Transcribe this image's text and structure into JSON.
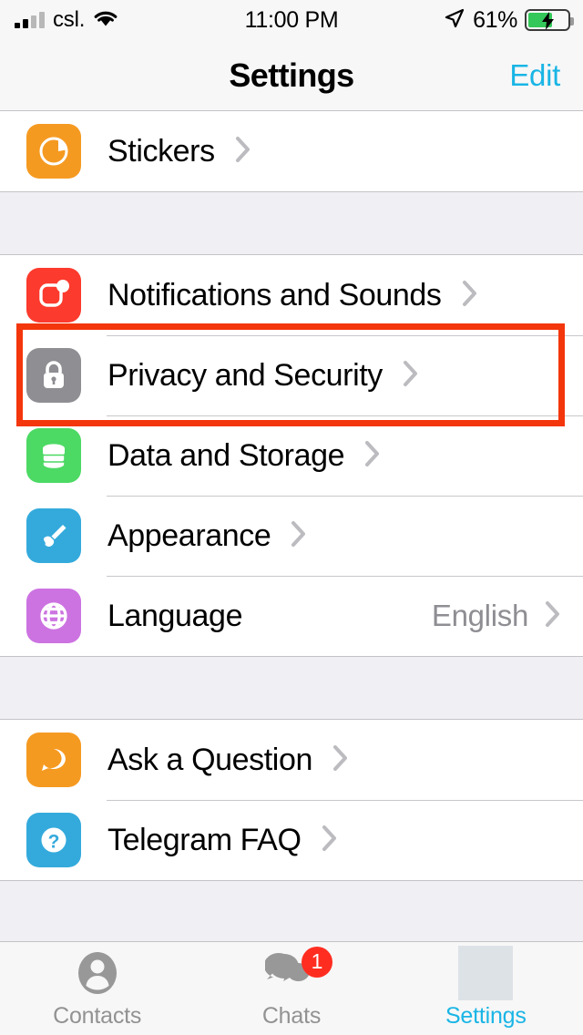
{
  "status_bar": {
    "carrier": "csl.",
    "signal_icon": "cellular-signal-icon",
    "wifi_icon": "wifi-icon",
    "time": "11:00 PM",
    "location_icon": "location-arrow-icon",
    "battery_percent": "61%",
    "battery_level": 61,
    "battery_charging": true,
    "battery_color": "#34c759"
  },
  "nav_bar": {
    "title": "Settings",
    "edit_label": "Edit",
    "accent_color": "#19b5e5"
  },
  "highlight": {
    "color": "#f4360c",
    "target": "Privacy and Security"
  },
  "groups": [
    {
      "rows": [
        {
          "label": "Stickers",
          "icon": "stickers-icon",
          "icon_color": "#f59a21",
          "value": "",
          "chevron": true
        }
      ]
    },
    {
      "rows": [
        {
          "label": "Notifications and Sounds",
          "icon": "notifications-icon",
          "icon_color": "#fc3a2d",
          "value": "",
          "chevron": true
        },
        {
          "label": "Privacy and Security",
          "icon": "lock-icon",
          "icon_color": "#8e8e93",
          "value": "",
          "chevron": true
        },
        {
          "label": "Data and Storage",
          "icon": "database-icon",
          "icon_color": "#4cd964",
          "value": "",
          "chevron": true
        },
        {
          "label": "Appearance",
          "icon": "paintbrush-icon",
          "icon_color": "#34aadc",
          "value": "",
          "chevron": true
        },
        {
          "label": "Language",
          "icon": "globe-icon",
          "icon_color": "#cc73e1",
          "value": "English",
          "chevron": true
        }
      ]
    },
    {
      "rows": [
        {
          "label": "Ask a Question",
          "icon": "chat-bubble-dots-icon",
          "icon_color": "#f59a21",
          "value": "",
          "chevron": true
        },
        {
          "label": "Telegram FAQ",
          "icon": "question-mark-icon",
          "icon_color": "#34aadc",
          "value": "",
          "chevron": true
        }
      ]
    }
  ],
  "tab_bar": {
    "tabs": [
      {
        "label": "Contacts",
        "icon": "person-icon",
        "active": false,
        "badge": ""
      },
      {
        "label": "Chats",
        "icon": "chats-icon",
        "active": false,
        "badge": "1"
      },
      {
        "label": "Settings",
        "icon": "settings-placeholder-icon",
        "active": true,
        "badge": ""
      }
    ],
    "active_color": "#19b5e5",
    "inactive_color": "#929292",
    "badge_color": "#ff2d20"
  }
}
